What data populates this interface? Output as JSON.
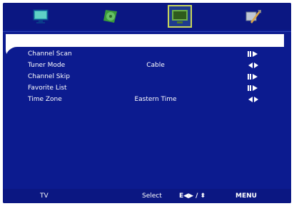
{
  "tabs": [
    {
      "name": "picture-tab",
      "icon": "tv-icon",
      "selected": false
    },
    {
      "name": "audio-tab",
      "icon": "green-disc-icon",
      "selected": false
    },
    {
      "name": "channel-tab",
      "icon": "channel-screen-icon",
      "selected": true
    },
    {
      "name": "setup-tab",
      "icon": "tools-icon",
      "selected": false
    }
  ],
  "menu": {
    "items": [
      {
        "label": "Channel Scan",
        "value": "",
        "arrow": "enter-arrow-icon"
      },
      {
        "label": "Tuner Mode",
        "value": "Cable",
        "arrow": "left-right-arrow-icon"
      },
      {
        "label": "Channel Skip",
        "value": "",
        "arrow": "enter-arrow-icon"
      },
      {
        "label": "Favorite List",
        "value": "",
        "arrow": "enter-arrow-icon"
      },
      {
        "label": "Time Zone",
        "value": "Eastern Time",
        "arrow": "left-right-arrow-icon"
      }
    ]
  },
  "bottom_bar": {
    "source": "TV",
    "select_label": "Select",
    "nav_hint": "E◀▶ / ⬍",
    "menu_label": "MENU"
  },
  "colors": {
    "background": "#0c1b8f",
    "highlight": "#ffffff",
    "selected_tab_border": "#c9d65a"
  }
}
